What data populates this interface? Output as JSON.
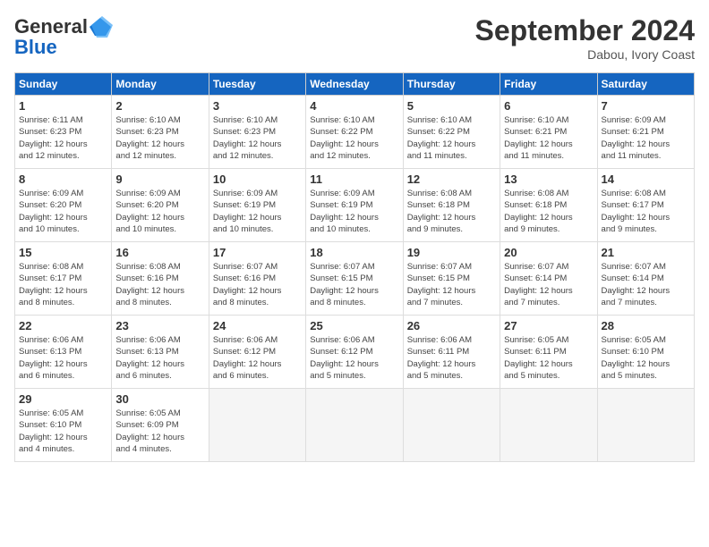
{
  "logo": {
    "line1": "General",
    "line2": "Blue"
  },
  "title": "September 2024",
  "subtitle": "Dabou, Ivory Coast",
  "days_of_week": [
    "Sunday",
    "Monday",
    "Tuesday",
    "Wednesday",
    "Thursday",
    "Friday",
    "Saturday"
  ],
  "weeks": [
    [
      {
        "day": "1",
        "sunrise": "6:11 AM",
        "sunset": "6:23 PM",
        "daylight": "12 hours and 12 minutes."
      },
      {
        "day": "2",
        "sunrise": "6:10 AM",
        "sunset": "6:23 PM",
        "daylight": "12 hours and 12 minutes."
      },
      {
        "day": "3",
        "sunrise": "6:10 AM",
        "sunset": "6:23 PM",
        "daylight": "12 hours and 12 minutes."
      },
      {
        "day": "4",
        "sunrise": "6:10 AM",
        "sunset": "6:22 PM",
        "daylight": "12 hours and 12 minutes."
      },
      {
        "day": "5",
        "sunrise": "6:10 AM",
        "sunset": "6:22 PM",
        "daylight": "12 hours and 11 minutes."
      },
      {
        "day": "6",
        "sunrise": "6:10 AM",
        "sunset": "6:21 PM",
        "daylight": "12 hours and 11 minutes."
      },
      {
        "day": "7",
        "sunrise": "6:09 AM",
        "sunset": "6:21 PM",
        "daylight": "12 hours and 11 minutes."
      }
    ],
    [
      {
        "day": "8",
        "sunrise": "6:09 AM",
        "sunset": "6:20 PM",
        "daylight": "12 hours and 10 minutes."
      },
      {
        "day": "9",
        "sunrise": "6:09 AM",
        "sunset": "6:20 PM",
        "daylight": "12 hours and 10 minutes."
      },
      {
        "day": "10",
        "sunrise": "6:09 AM",
        "sunset": "6:19 PM",
        "daylight": "12 hours and 10 minutes."
      },
      {
        "day": "11",
        "sunrise": "6:09 AM",
        "sunset": "6:19 PM",
        "daylight": "12 hours and 10 minutes."
      },
      {
        "day": "12",
        "sunrise": "6:08 AM",
        "sunset": "6:18 PM",
        "daylight": "12 hours and 9 minutes."
      },
      {
        "day": "13",
        "sunrise": "6:08 AM",
        "sunset": "6:18 PM",
        "daylight": "12 hours and 9 minutes."
      },
      {
        "day": "14",
        "sunrise": "6:08 AM",
        "sunset": "6:17 PM",
        "daylight": "12 hours and 9 minutes."
      }
    ],
    [
      {
        "day": "15",
        "sunrise": "6:08 AM",
        "sunset": "6:17 PM",
        "daylight": "12 hours and 8 minutes."
      },
      {
        "day": "16",
        "sunrise": "6:08 AM",
        "sunset": "6:16 PM",
        "daylight": "12 hours and 8 minutes."
      },
      {
        "day": "17",
        "sunrise": "6:07 AM",
        "sunset": "6:16 PM",
        "daylight": "12 hours and 8 minutes."
      },
      {
        "day": "18",
        "sunrise": "6:07 AM",
        "sunset": "6:15 PM",
        "daylight": "12 hours and 8 minutes."
      },
      {
        "day": "19",
        "sunrise": "6:07 AM",
        "sunset": "6:15 PM",
        "daylight": "12 hours and 7 minutes."
      },
      {
        "day": "20",
        "sunrise": "6:07 AM",
        "sunset": "6:14 PM",
        "daylight": "12 hours and 7 minutes."
      },
      {
        "day": "21",
        "sunrise": "6:07 AM",
        "sunset": "6:14 PM",
        "daylight": "12 hours and 7 minutes."
      }
    ],
    [
      {
        "day": "22",
        "sunrise": "6:06 AM",
        "sunset": "6:13 PM",
        "daylight": "12 hours and 6 minutes."
      },
      {
        "day": "23",
        "sunrise": "6:06 AM",
        "sunset": "6:13 PM",
        "daylight": "12 hours and 6 minutes."
      },
      {
        "day": "24",
        "sunrise": "6:06 AM",
        "sunset": "6:12 PM",
        "daylight": "12 hours and 6 minutes."
      },
      {
        "day": "25",
        "sunrise": "6:06 AM",
        "sunset": "6:12 PM",
        "daylight": "12 hours and 5 minutes."
      },
      {
        "day": "26",
        "sunrise": "6:06 AM",
        "sunset": "6:11 PM",
        "daylight": "12 hours and 5 minutes."
      },
      {
        "day": "27",
        "sunrise": "6:05 AM",
        "sunset": "6:11 PM",
        "daylight": "12 hours and 5 minutes."
      },
      {
        "day": "28",
        "sunrise": "6:05 AM",
        "sunset": "6:10 PM",
        "daylight": "12 hours and 5 minutes."
      }
    ],
    [
      {
        "day": "29",
        "sunrise": "6:05 AM",
        "sunset": "6:10 PM",
        "daylight": "12 hours and 4 minutes."
      },
      {
        "day": "30",
        "sunrise": "6:05 AM",
        "sunset": "6:09 PM",
        "daylight": "12 hours and 4 minutes."
      },
      null,
      null,
      null,
      null,
      null
    ]
  ]
}
